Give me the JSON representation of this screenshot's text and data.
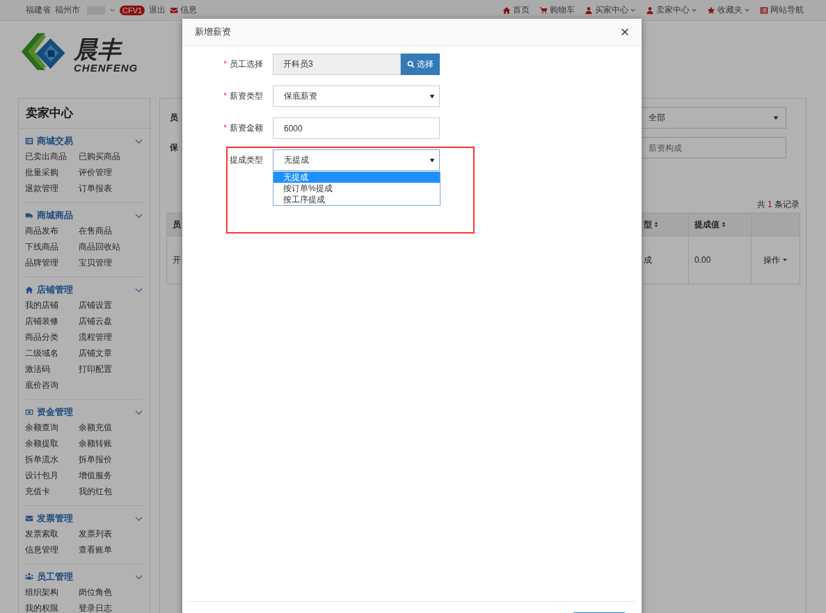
{
  "top_bar": {
    "province": "福建省",
    "city": "福州市",
    "badge": "CFV1",
    "logout": "退出",
    "messages": "信息",
    "links": [
      {
        "kind": "home",
        "label": "首页",
        "dropdown": false
      },
      {
        "kind": "cart",
        "label": "购物车",
        "dropdown": false
      },
      {
        "kind": "user",
        "label": "买家中心",
        "dropdown": true
      },
      {
        "kind": "user",
        "label": "卖家中心",
        "dropdown": true
      },
      {
        "kind": "star",
        "label": "收藏夹",
        "dropdown": true
      },
      {
        "kind": "list",
        "label": "网站导航",
        "dropdown": false
      }
    ]
  },
  "logo": {
    "name": "晨丰",
    "latin": "CHENFENG"
  },
  "sidebar": {
    "title": "卖家中心",
    "sections": [
      {
        "kind": "list",
        "title": "商城交易",
        "items": [
          "已卖出商品",
          "已购买商品",
          "批量采购",
          "评价管理",
          "退款管理",
          "订单报表"
        ]
      },
      {
        "kind": "truck",
        "title": "商城商品",
        "items": [
          "商品发布",
          "在售商品",
          "下线商品",
          "商品回收站",
          "品牌管理",
          "宝贝管理"
        ]
      },
      {
        "kind": "home",
        "title": "店铺管理",
        "items": [
          "我的店铺",
          "店铺设置",
          "店铺装修",
          "店铺云盘",
          "商品分类",
          "流程管理",
          "二级域名",
          "店铺文章",
          "激活码",
          "打印配置",
          "底价咨询"
        ]
      },
      {
        "kind": "money",
        "title": "资金管理",
        "items": [
          "余额查询",
          "余额充值",
          "余额提取",
          "余额转账",
          "拆单流水",
          "拆单报价",
          "设计包月",
          "增值服务",
          "充值卡",
          "我的红包"
        ]
      },
      {
        "kind": "envelope",
        "title": "发票管理",
        "items": [
          "发票索取",
          "发票列表",
          "信息管理",
          "查看账单"
        ]
      },
      {
        "kind": "users",
        "title": "员工管理",
        "items": [
          "组织架构",
          "岗位角色",
          "我的权限",
          "登录日志"
        ]
      }
    ]
  },
  "main": {
    "filter_labels": [
      "员",
      "保"
    ],
    "status_select": "全部",
    "search_placeholder": "薪资构成",
    "record_count": {
      "prefix": "共",
      "count": "1",
      "suffix": "条记录"
    },
    "table": {
      "columns": [
        {
          "label": "员",
          "sortable": false
        },
        {
          "label": "型",
          "sortable": true
        },
        {
          "label": "提成值",
          "sortable": true
        }
      ],
      "rows": [
        {
          "column_1": "开",
          "column_2": "成",
          "commission_value": "0.00",
          "action": "操作"
        }
      ]
    }
  },
  "modal": {
    "title": "新增薪资",
    "required_marker": "*",
    "fields": [
      {
        "kind": "picker",
        "label": "员工选择",
        "required": true,
        "value": "开科员3",
        "button": "选择",
        "highlighted": false
      },
      {
        "kind": "select",
        "label": "薪资类型",
        "required": true,
        "value": "保底薪资",
        "highlighted": false
      },
      {
        "kind": "input",
        "label": "薪资金额",
        "required": true,
        "value": "6000",
        "highlighted": false
      },
      {
        "kind": "select",
        "label": "提成类型",
        "required": false,
        "value": "无提成",
        "highlighted": true,
        "options": [
          {
            "label": "无提成",
            "selected": true
          },
          {
            "label": "按订单%提成",
            "selected": false
          },
          {
            "label": "按工序提成",
            "selected": false
          }
        ]
      }
    ]
  }
}
